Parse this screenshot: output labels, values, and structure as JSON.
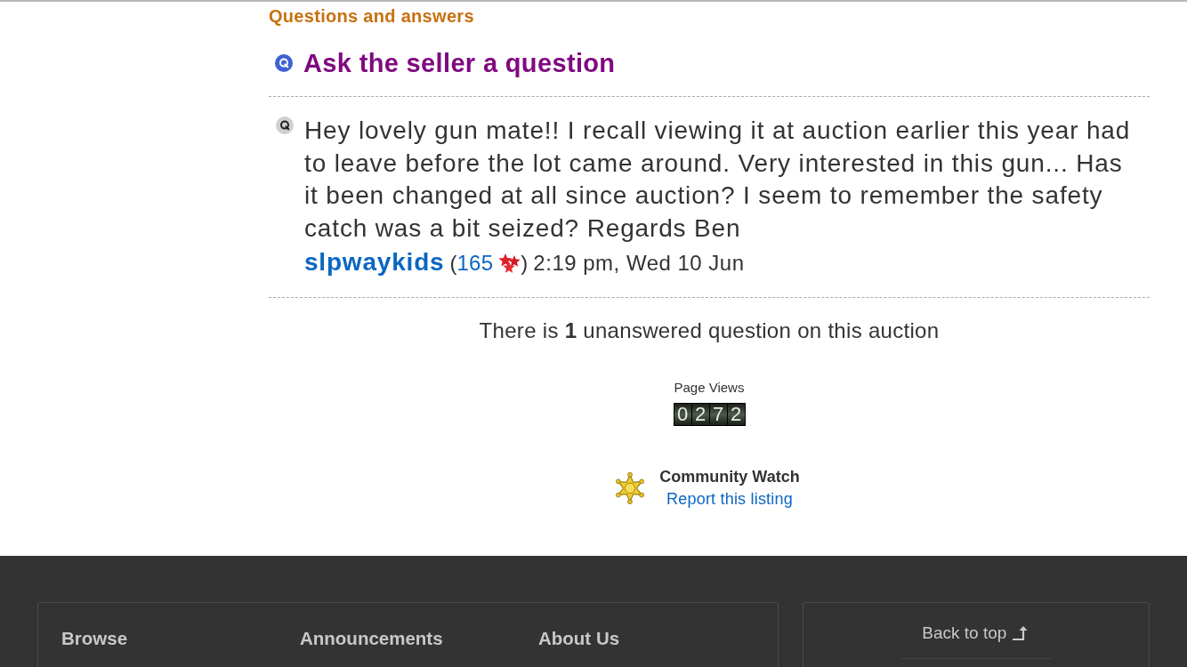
{
  "section_title": "Questions and answers",
  "ask_link": "Ask the seller a question",
  "questions": [
    {
      "text": "Hey lovely gun mate!! I recall viewing it at auction earlier this year had to leave before the lot came around. Very interested in this gun... Has it been changed at all since auction? I seem to remember the safety catch was a bit seized? Regards Ben",
      "author": "slpwaykids",
      "open_paren": "(",
      "feedback": "165",
      "close_paren": ")",
      "time": "2:19 pm, Wed 10 Jun"
    }
  ],
  "unanswered_note": "There is **1** unanswered question on this auction",
  "page_views": {
    "label": "Page Views",
    "digits": [
      "0",
      "2",
      "7",
      "2"
    ]
  },
  "community_watch": {
    "title": "Community Watch",
    "link": "Report this listing"
  },
  "footer": {
    "columns": [
      {
        "heading": "Browse"
      },
      {
        "heading": "Announcements"
      },
      {
        "heading": "About Us"
      }
    ],
    "back_to_top": "Back to top"
  }
}
